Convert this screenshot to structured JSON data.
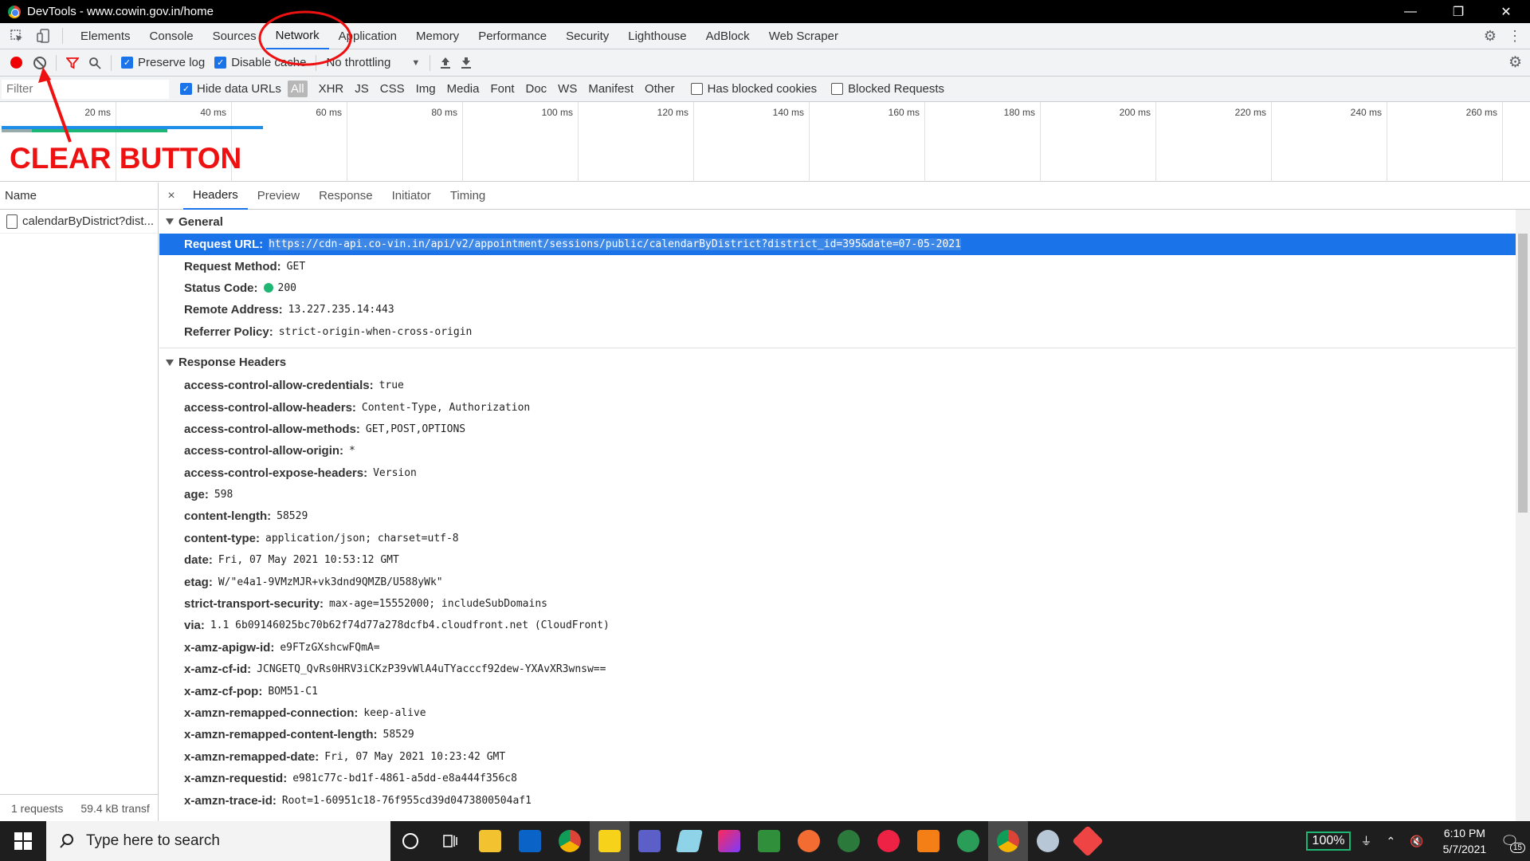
{
  "window": {
    "title": "DevTools - www.cowin.gov.in/home",
    "minimize": "—",
    "restore": "❐",
    "close": "✕"
  },
  "tabs": [
    {
      "label": "Elements"
    },
    {
      "label": "Console"
    },
    {
      "label": "Sources"
    },
    {
      "label": "Network"
    },
    {
      "label": "Application"
    },
    {
      "label": "Memory"
    },
    {
      "label": "Performance"
    },
    {
      "label": "Security"
    },
    {
      "label": "Lighthouse"
    },
    {
      "label": "AdBlock"
    },
    {
      "label": "Web Scraper"
    }
  ],
  "network_toolbar": {
    "preserve_log": "Preserve log",
    "disable_cache": "Disable cache",
    "throttling": "No throttling"
  },
  "filterbar": {
    "placeholder": "Filter",
    "hide_data_urls": "Hide data URLs",
    "types": [
      "All",
      "XHR",
      "JS",
      "CSS",
      "Img",
      "Media",
      "Font",
      "Doc",
      "WS",
      "Manifest",
      "Other"
    ],
    "has_blocked_cookies": "Has blocked cookies",
    "blocked_requests": "Blocked Requests"
  },
  "timeline": {
    "ticks": [
      "20 ms",
      "40 ms",
      "60 ms",
      "80 ms",
      "100 ms",
      "120 ms",
      "140 ms",
      "160 ms",
      "180 ms",
      "200 ms",
      "220 ms",
      "240 ms",
      "260 ms"
    ]
  },
  "annotation": {
    "label": "CLEAR BUTTON",
    "color": "#e11111"
  },
  "request_list": {
    "header": "Name",
    "items": [
      "calendarByDistrict?dist..."
    ],
    "footer_requests": "1 requests",
    "footer_transfer": "59.4 kB transf"
  },
  "detail": {
    "close": "×",
    "tabs": [
      "Headers",
      "Preview",
      "Response",
      "Initiator",
      "Timing"
    ],
    "general_title": "General",
    "general": [
      {
        "k": "Request URL:",
        "v": "https://cdn-api.co-vin.in/api/v2/appointment/sessions/public/calendarByDistrict?district_id=395&date=07-05-2021"
      },
      {
        "k": "Request Method:",
        "v": "GET"
      },
      {
        "k": "Status Code:",
        "v": "200"
      },
      {
        "k": "Remote Address:",
        "v": "13.227.235.14:443"
      },
      {
        "k": "Referrer Policy:",
        "v": "strict-origin-when-cross-origin"
      }
    ],
    "response_title": "Response Headers",
    "response": [
      {
        "k": "access-control-allow-credentials:",
        "v": "true"
      },
      {
        "k": "access-control-allow-headers:",
        "v": "Content-Type, Authorization"
      },
      {
        "k": "access-control-allow-methods:",
        "v": "GET,POST,OPTIONS"
      },
      {
        "k": "access-control-allow-origin:",
        "v": "*"
      },
      {
        "k": "access-control-expose-headers:",
        "v": "Version"
      },
      {
        "k": "age:",
        "v": "598"
      },
      {
        "k": "content-length:",
        "v": "58529"
      },
      {
        "k": "content-type:",
        "v": "application/json; charset=utf-8"
      },
      {
        "k": "date:",
        "v": "Fri, 07 May 2021 10:53:12 GMT"
      },
      {
        "k": "etag:",
        "v": "W/\"e4a1-9VMzMJR+vk3dnd9QMZB/U588yWk\""
      },
      {
        "k": "strict-transport-security:",
        "v": "max-age=15552000; includeSubDomains"
      },
      {
        "k": "via:",
        "v": "1.1 6b09146025bc70b62f74d77a278dcfb4.cloudfront.net (CloudFront)"
      },
      {
        "k": "x-amz-apigw-id:",
        "v": "e9FTzGXshcwFQmA="
      },
      {
        "k": "x-amz-cf-id:",
        "v": "JCNGETQ_QvRs0HRV3iCKzP39vWlA4uTYacccf92dew-YXAvXR3wnsw=="
      },
      {
        "k": "x-amz-cf-pop:",
        "v": "BOM51-C1"
      },
      {
        "k": "x-amzn-remapped-connection:",
        "v": "keep-alive"
      },
      {
        "k": "x-amzn-remapped-content-length:",
        "v": "58529"
      },
      {
        "k": "x-amzn-remapped-date:",
        "v": "Fri, 07 May 2021 10:23:42 GMT"
      },
      {
        "k": "x-amzn-requestid:",
        "v": "e981c77c-bd1f-4861-a5dd-e8a444f356c8"
      },
      {
        "k": "x-amzn-trace-id:",
        "v": "Root=1-60951c18-76f955cd39d0473800504af1"
      }
    ]
  },
  "taskbar": {
    "search_placeholder": "Type here to search",
    "battery": "100%",
    "time": "6:10 PM",
    "date": "5/7/2021",
    "notifications": "15"
  },
  "colors": {
    "accent": "#1a73e8",
    "record": "#ee0000",
    "status_ok": "#1db672"
  }
}
